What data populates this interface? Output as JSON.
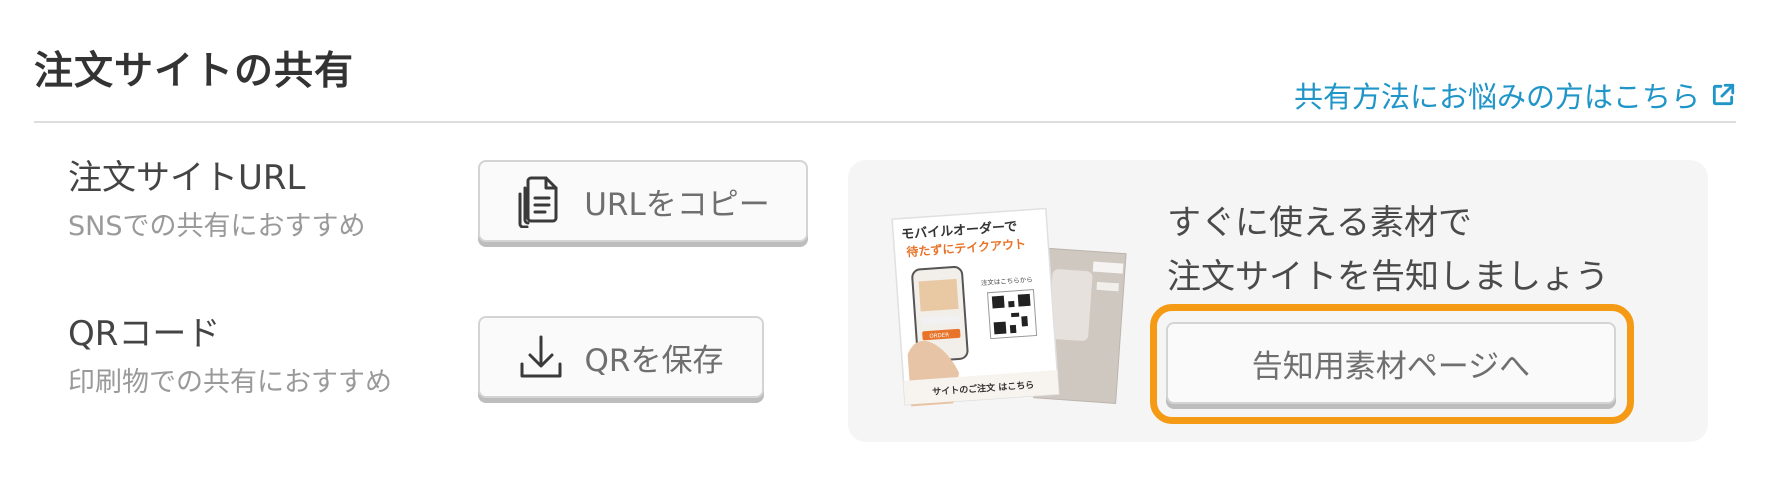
{
  "header": {
    "title": "注文サイトの共有",
    "help_link": "共有方法にお悩みの方はこちら"
  },
  "url_row": {
    "title": "注文サイトURL",
    "subtitle": "SNSでの共有におすすめ",
    "button_label": "URLをコピー"
  },
  "qr_row": {
    "title": "QRコード",
    "subtitle": "印刷物での共有におすすめ",
    "button_label": "QRを保存"
  },
  "promo": {
    "line1": "すぐに使える素材で",
    "line2": "注文サイトを告知しましょう",
    "button_label": "告知用素材ページへ",
    "flyer": {
      "headline1": "モバイルオーダーで",
      "headline2": "待たずにテイクアウト",
      "qr_caption": "注文はこちらから",
      "phone_button": "ORDER",
      "footer": "サイトのご注文 はこちら"
    }
  },
  "colors": {
    "link": "#1f95c8",
    "highlight": "#f49a14",
    "flyer_accent": "#e8742a"
  }
}
